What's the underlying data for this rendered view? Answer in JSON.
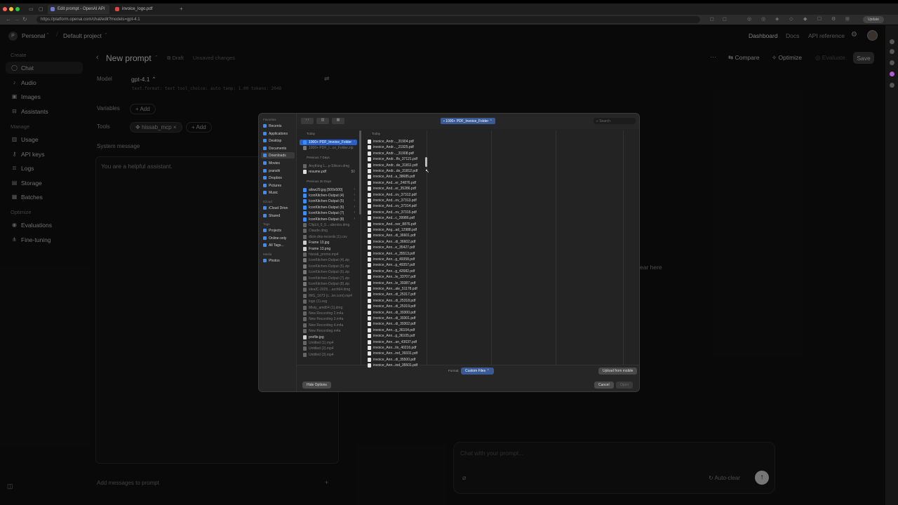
{
  "browser": {
    "tabs": [
      {
        "title": "Edit prompt - OpenAI API",
        "active": true
      },
      {
        "title": "invoice_logo.pdf",
        "active": false
      }
    ],
    "url": "https://platform.openai.com/chat/edit?models=gpt-4.1",
    "update_label": "Update"
  },
  "header": {
    "workspace_initial": "P",
    "workspace": "Personal",
    "project": "Default project",
    "nav": [
      "Dashboard",
      "Docs",
      "API reference"
    ]
  },
  "sidebar": {
    "sections": [
      {
        "label": "Create",
        "items": [
          {
            "label": "Chat",
            "icon": "chat-icon",
            "active": true
          },
          {
            "label": "Audio",
            "icon": "audio-icon"
          },
          {
            "label": "Images",
            "icon": "image-icon"
          },
          {
            "label": "Assistants",
            "icon": "assistant-icon"
          }
        ]
      },
      {
        "label": "Manage",
        "items": [
          {
            "label": "Usage",
            "icon": "usage-icon"
          },
          {
            "label": "API keys",
            "icon": "key-icon"
          },
          {
            "label": "Logs",
            "icon": "logs-icon"
          },
          {
            "label": "Storage",
            "icon": "storage-icon"
          },
          {
            "label": "Batches",
            "icon": "batches-icon"
          }
        ]
      },
      {
        "label": "Optimize",
        "items": [
          {
            "label": "Evaluations",
            "icon": "evaluations-icon"
          },
          {
            "label": "Fine-tuning",
            "icon": "fine-tuning-icon"
          }
        ]
      }
    ]
  },
  "prompt": {
    "title": "New prompt",
    "draft": "Draft",
    "unsaved": "Unsaved changes",
    "compare": "Compare",
    "optimize": "Optimize",
    "evaluate": "Evaluate",
    "save": "Save",
    "model_label": "Model",
    "model": "gpt-4.1",
    "params": "text.format: text  tool_choice: auto  temp: 1.00  tokens: 2048",
    "variables_label": "Variables",
    "add": "+ Add",
    "tools_label": "Tools",
    "tool_chip": "hissab_mcp",
    "system_label": "System message",
    "system_text": "You are a helpful assistant.",
    "add_messages": "Add messages to prompt",
    "chat_placeholder": "Chat with your prompt...",
    "auto_clear": "Auto-clear",
    "empty_hint": "ear here"
  },
  "dialog": {
    "sidebar": {
      "favorites_label": "Favorites",
      "favorites": [
        "Recents",
        "Applications",
        "Desktop",
        "Documents",
        "Downloads",
        "Movies",
        "pranshi",
        "Dropbox",
        "Pictures",
        "Music"
      ],
      "icloud_label": "iCloud",
      "icloud": [
        "iCloud Drive",
        "Shared"
      ],
      "tags_label": "Tags",
      "tags": [
        "Projects",
        "Online-only",
        "All Tags..."
      ],
      "media_label": "Media",
      "media": [
        "Photos"
      ]
    },
    "path": "1000+ PDF_Invoice_Folder",
    "search_placeholder": "Search",
    "col1": {
      "today_label": "Today",
      "today": [
        {
          "name": "1000+ PDF_Invoice_Folder",
          "type": "folder",
          "selected": true
        },
        {
          "name": "1000+ PDF_I...ce_Folder.zip",
          "type": "zip",
          "dim": true
        }
      ],
      "prev7_label": "Previous 7 Days",
      "prev7": [
        {
          "name": "Anything L...p-Silicon.dmg",
          "type": "file",
          "dim": true
        },
        {
          "name": "resume.pdf",
          "type": "pdf",
          "size": "$0"
        }
      ],
      "prev30_label": "Previous 30 Days",
      "prev30": [
        {
          "name": "alisw29.jpg [500x500]",
          "type": "folder"
        },
        {
          "name": "IconKitchen-Output (4)",
          "type": "folder"
        },
        {
          "name": "IconKitchen-Output (5)",
          "type": "folder"
        },
        {
          "name": "IconKitchen-Output (6)",
          "type": "folder"
        },
        {
          "name": "IconKitchen-Output (7)",
          "type": "folder"
        },
        {
          "name": "IconKitchen-Output (8)",
          "type": "folder"
        },
        {
          "name": "ClipLit_0_5...-abrnixo.dmg",
          "type": "file",
          "dim": true
        },
        {
          "name": "Claude.dmg",
          "type": "file",
          "dim": true
        },
        {
          "name": "dicin-dns-records (1).csv",
          "type": "file",
          "dim": true
        },
        {
          "name": "Frame 13.jpg",
          "type": "img"
        },
        {
          "name": "Frame 13.png",
          "type": "img"
        },
        {
          "name": "hissab_promo.mp4",
          "type": "file",
          "dim": true
        },
        {
          "name": "IconKitchen-Output (4).zip",
          "type": "zip",
          "dim": true
        },
        {
          "name": "IconKitchen-Output (5).zip",
          "type": "zip",
          "dim": true
        },
        {
          "name": "IconKitchen-Output (6).zip",
          "type": "zip",
          "dim": true
        },
        {
          "name": "IconKitchen-Output (7).zip",
          "type": "zip",
          "dim": true
        },
        {
          "name": "IconKitchen-Output (8).zip",
          "type": "zip",
          "dim": true
        },
        {
          "name": "ideaIC-2025....arch64.dmg",
          "type": "file",
          "dim": true
        },
        {
          "name": "IMG_1673 (c...ler.com).mp4",
          "type": "file",
          "dim": true
        },
        {
          "name": "logo (1).svg",
          "type": "file",
          "dim": true
        },
        {
          "name": "Misty_amd64 (1).dmg",
          "type": "file",
          "dim": true
        },
        {
          "name": "New Recording 2.m4a",
          "type": "file",
          "dim": true
        },
        {
          "name": "New Recording 3.m4a",
          "type": "file",
          "dim": true
        },
        {
          "name": "New Recording 4.m4a",
          "type": "file",
          "dim": true
        },
        {
          "name": "New Recording.m4a",
          "type": "file",
          "dim": true
        },
        {
          "name": "profile.jpg",
          "type": "img"
        },
        {
          "name": "Untitled (1).mp4",
          "type": "file",
          "dim": true
        },
        {
          "name": "Untitled (2).mp4",
          "type": "file",
          "dim": true
        },
        {
          "name": "Untitled (3).mp4",
          "type": "file",
          "dim": true
        }
      ]
    },
    "col2": {
      "today_label": "Today",
      "files": [
        "invoice_Andr..._31904.pdf",
        "invoice_Andr..._21925.pdf",
        "invoice_Andr..._31908.pdf",
        "invoice_Andr...ffs_37121.pdf",
        "invoice_Andr...de_31811.pdf",
        "invoice_Andr...de_31812.pdf",
        "invoice_And...a_38685.pdf",
        "invoice_And...er_24876.pdf",
        "invoice_And...er_35286.pdf",
        "invoice_And...ov_37312.pdf",
        "invoice_And...ov_37313.pdf",
        "invoice_And...ov_37314.pdf",
        "invoice_And...ov_37315.pdf",
        "invoice_And...c_39986.pdf",
        "invoice_And...ner_8876.pdf",
        "invoice_Ang...ad_12988.pdf",
        "invoice_Ann...di_36601.pdf",
        "invoice_Ann...di_36602.pdf",
        "invoice_Ann...e_35427.pdf",
        "invoice_Ann...e_35513.pdf",
        "invoice_Ann...g_49358.pdf",
        "invoice_Ann...g_49357.pdf",
        "invoice_Ann...g_42682.pdf",
        "invoice_Ann...le_33707.pdf",
        "invoice_Ann...le_39387.pdf",
        "invoice_Ann...ale_51178.pdf",
        "invoice_Ann...di_25317.pdf",
        "invoice_Ann...di_25318.pdf",
        "invoice_Ann...di_25319.pdf",
        "invoice_Ann...di_39300.pdf",
        "invoice_Ann...di_39301.pdf",
        "invoice_Ann...di_39302.pdf",
        "invoice_Ann...g_36104.pdf",
        "invoice_Ann...g_36105.pdf",
        "invoice_Ann...an_43637.pdf",
        "invoice_Ann...lin_40216.pdf",
        "invoice_Ann...ind_39331.pdf",
        "invoice_Ann...di_35500.pdf",
        "invoice_Ann...ind_35501.pdf"
      ]
    },
    "format_label": "Format:",
    "format_value": "Custom Files",
    "upload_mobile": "Upload from mobile",
    "hide_options": "Hide Options",
    "cancel": "Cancel",
    "open": "Open"
  }
}
